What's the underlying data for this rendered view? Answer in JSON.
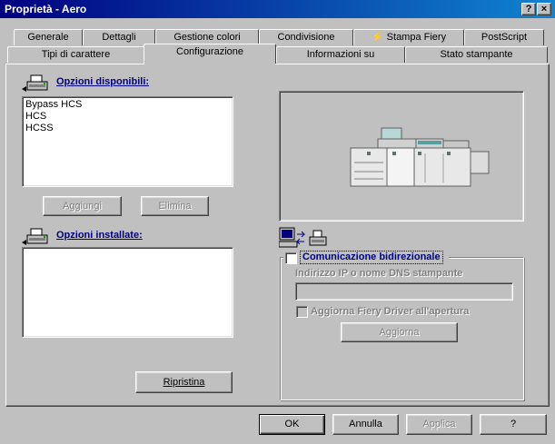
{
  "window": {
    "title": "Proprietà - Aero",
    "help_button": "?",
    "close_button": "×"
  },
  "tabs_row1": [
    "Generale",
    "Dettagli",
    "Gestione colori",
    "Condivisione",
    "Stampa Fiery",
    "PostScript"
  ],
  "tabs_row2": [
    "Tipi di carattere",
    "Configurazione",
    "Informazioni su",
    "Stato stampante"
  ],
  "selected_tab": "Configurazione",
  "available_options": {
    "label": "Opzioni disponibili:",
    "items": [
      "Bypass HCS",
      "HCS",
      "HCSS"
    ]
  },
  "buttons": {
    "add": "Aggiungi",
    "remove": "Elimina",
    "restore": "Ripristina",
    "update": "Aggiorna"
  },
  "installed_options": {
    "label": "Opzioni installate:",
    "items": []
  },
  "bidirectional": {
    "label": "Comunicazione bidirezionale",
    "checked": false,
    "ip_label": "Indirizzo IP o nome DNS stampante",
    "ip_value": "",
    "update_driver_label": "Aggiorna Fiery Driver all'apertura",
    "update_driver_checked": false
  },
  "footer": {
    "ok": "OK",
    "cancel": "Annulla",
    "apply": "Applica",
    "help": "?"
  },
  "icons": [
    "printer-icon",
    "computer-printer-link-icon",
    "lightning-icon",
    "copier-machine-image"
  ]
}
